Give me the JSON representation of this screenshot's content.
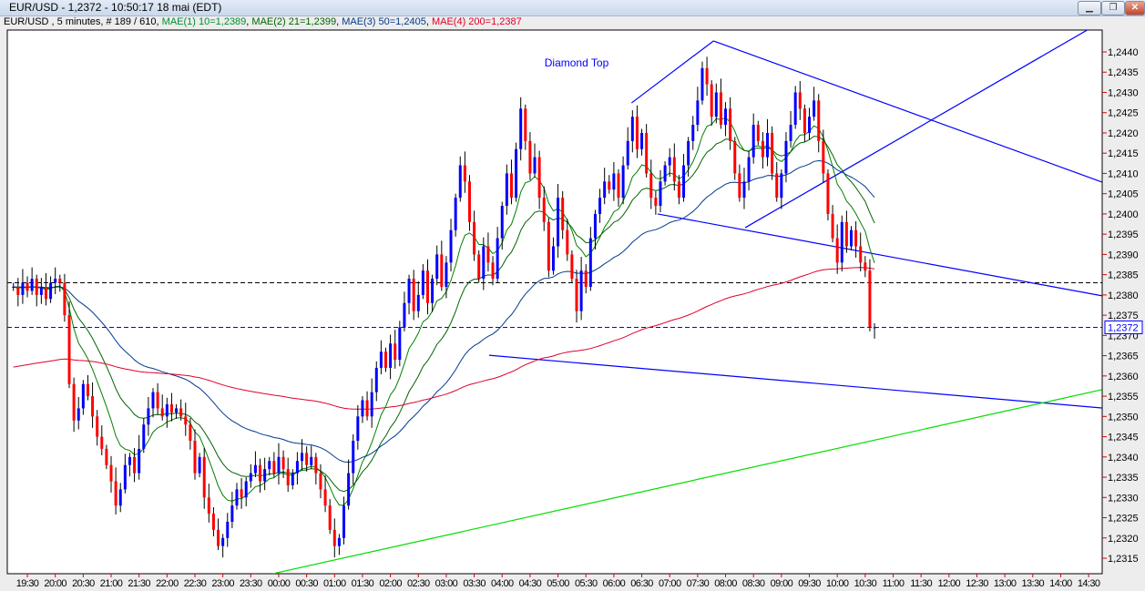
{
  "window": {
    "title": "EUR/USD - 1,2372 - 10:50:17  18 mai (EDT)",
    "buttons": {
      "minimize": "minimize-icon",
      "restore": "restore-icon",
      "close": "close-icon"
    }
  },
  "legend": {
    "symbol": "EUR/USD , 5 minutes, # 189 / 610",
    "ma1": "MAE(1) 10=1,2389",
    "ma2": "MAE(2) 21=1,2399",
    "ma3": "MAE(3) 50=1,2405",
    "ma4": "MAE(4) 200=1,2387"
  },
  "colors": {
    "up": "#0000ff",
    "down": "#ff0000",
    "ma1": "#008000",
    "ma2": "#006400",
    "ma3": "#003a8c",
    "ma4": "#e0002a",
    "trend_blue": "#0000ff",
    "trend_green": "#00dd00"
  },
  "chart_data": {
    "type": "candlestick",
    "title": "",
    "annotation": "Diamond Top",
    "symbol": "EUR/USD",
    "interval_minutes": 5,
    "start_time": "19:15",
    "first_open": 1.2382,
    "close": [
      1.2382,
      1.238,
      1.2383,
      1.2381,
      1.2384,
      1.238,
      1.2382,
      1.2379,
      1.2383,
      1.2384,
      1.2383,
      1.2375,
      1.2358,
      1.2349,
      1.2352,
      1.2358,
      1.2355,
      1.235,
      1.2345,
      1.2342,
      1.2338,
      1.2334,
      1.2328,
      1.2332,
      1.2338,
      1.234,
      1.2336,
      1.2342,
      1.2348,
      1.2352,
      1.2356,
      1.2352,
      1.235,
      1.2353,
      1.2351,
      1.2352,
      1.235,
      1.2348,
      1.2344,
      1.2336,
      1.234,
      1.233,
      1.2326,
      1.2322,
      1.2318,
      1.232,
      1.2324,
      1.2328,
      1.2332,
      1.233,
      1.2334,
      1.2336,
      1.2338,
      1.2334,
      1.2337,
      1.2339,
      1.2336,
      1.234,
      1.2337,
      1.2333,
      1.2336,
      1.2339,
      1.2341,
      1.2338,
      1.234,
      1.2336,
      1.2332,
      1.2328,
      1.2322,
      1.2318,
      1.232,
      1.2328,
      1.2336,
      1.2344,
      1.235,
      1.2354,
      1.235,
      1.2356,
      1.2362,
      1.2366,
      1.2362,
      1.2368,
      1.2364,
      1.2372,
      1.2378,
      1.2384,
      1.2376,
      1.238,
      1.2386,
      1.2378,
      1.2384,
      1.239,
      1.2382,
      1.2388,
      1.2396,
      1.2404,
      1.2412,
      1.2408,
      1.2398,
      1.239,
      1.2384,
      1.2392,
      1.2388,
      1.2384,
      1.2394,
      1.2402,
      1.241,
      1.2404,
      1.2416,
      1.2426,
      1.2418,
      1.241,
      1.2414,
      1.2404,
      1.2398,
      1.2386,
      1.2392,
      1.2404,
      1.2396,
      1.239,
      1.2384,
      1.2376,
      1.2386,
      1.2382,
      1.2394,
      1.24,
      1.2404,
      1.2408,
      1.2406,
      1.241,
      1.2404,
      1.2412,
      1.2418,
      1.2424,
      1.2416,
      1.242,
      1.241,
      1.2404,
      1.2402,
      1.2408,
      1.2412,
      1.2414,
      1.2408,
      1.2404,
      1.2412,
      1.2418,
      1.2422,
      1.2428,
      1.2436,
      1.2432,
      1.2424,
      1.243,
      1.2422,
      1.2426,
      1.2418,
      1.241,
      1.2404,
      1.2408,
      1.2414,
      1.2422,
      1.2418,
      1.2414,
      1.242,
      1.241,
      1.2404,
      1.241,
      1.2418,
      1.2422,
      1.243,
      1.2426,
      1.242,
      1.2424,
      1.2428,
      1.2418,
      1.241,
      1.24,
      1.2394,
      1.2388,
      1.2398,
      1.2392,
      1.2396,
      1.2392,
      1.2388,
      1.2386,
      1.2372,
      1.2372
    ],
    "moving_averages": [
      {
        "name": "MAE(1)",
        "period": 10,
        "color": "#008000"
      },
      {
        "name": "MAE(2)",
        "period": 21,
        "color": "#006400"
      },
      {
        "name": "MAE(3)",
        "period": 50,
        "color": "#003a8c"
      },
      {
        "name": "MAE(4)",
        "period": 200,
        "color": "#e0002a"
      }
    ],
    "y_ticks": [
      "1,2440",
      "1,2435",
      "1,2430",
      "1,2425",
      "1,2420",
      "1,2415",
      "1,2410",
      "1,2405",
      "1,2400",
      "1,2395",
      "1,2390",
      "1,2385",
      "1,2380",
      "1,2375",
      "1,2370",
      "1,2365",
      "1,2360",
      "1,2355",
      "1,2350",
      "1,2345",
      "1,2340",
      "1,2335",
      "1,2330",
      "1,2325",
      "1,2320",
      "1,2315"
    ],
    "ylim": [
      1.231,
      1.2447
    ],
    "x_ticks": [
      "19:30",
      "20:00",
      "20:30",
      "21:00",
      "21:30",
      "22:00",
      "22:30",
      "23:00",
      "23:30",
      "00:00",
      "00:30",
      "01:00",
      "01:30",
      "02:00",
      "02:30",
      "03:00",
      "03:30",
      "04:00",
      "04:30",
      "05:00",
      "05:30",
      "06:00",
      "06:30",
      "07:00",
      "07:30",
      "08:00",
      "08:30",
      "09:00",
      "09:30",
      "10:00",
      "10:30",
      "11:00",
      "11:30",
      "12:00",
      "12:30",
      "13:00",
      "13:30",
      "14:00",
      "14:30"
    ],
    "current_price": {
      "value": 1.2372,
      "label": "1,2372"
    },
    "horizontal_lines": [
      {
        "price": 1.2383,
        "color": "#000000",
        "style": "dashed"
      },
      {
        "price": 1.2372,
        "color": "#0000ff",
        "style": "dashed"
      }
    ],
    "trendlines": [
      {
        "from": [
          "06:19",
          1.24274
        ],
        "to": [
          "07:47",
          1.24427
        ],
        "color": "#0000ff"
      },
      {
        "from": [
          "07:47",
          1.24427
        ],
        "to": [
          "14:44",
          1.24079
        ],
        "color": "#0000ff"
      },
      {
        "from": [
          "06:47",
          1.24
        ],
        "to": [
          "14:44",
          1.23798
        ],
        "color": "#0000ff"
      },
      {
        "from": [
          "08:21",
          1.23966
        ],
        "to": [
          "14:30",
          1.24456
        ],
        "color": "#0000ff"
      },
      {
        "from": [
          "03:46",
          1.23651
        ],
        "to": [
          "14:44",
          1.23521
        ],
        "color": "#0000ff"
      },
      {
        "from": [
          "23:54",
          1.23112
        ],
        "to": [
          "14:44",
          1.23566
        ],
        "color": "#00dd00"
      }
    ],
    "grid": false
  }
}
